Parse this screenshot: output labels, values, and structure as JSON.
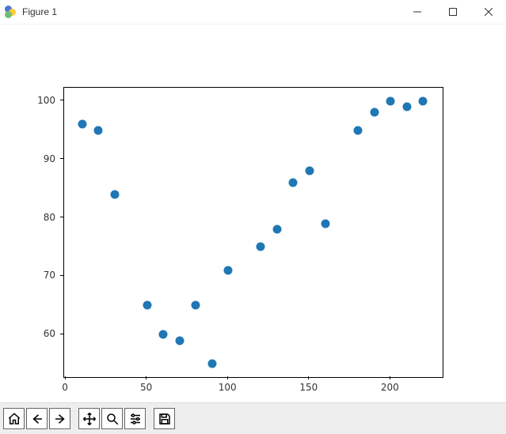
{
  "window": {
    "title": "Figure 1"
  },
  "chart_data": {
    "type": "scatter",
    "x": [
      10,
      20,
      30,
      50,
      60,
      70,
      80,
      90,
      100,
      120,
      130,
      140,
      150,
      160,
      180,
      190,
      200,
      210,
      220
    ],
    "y": [
      96,
      95,
      84,
      65,
      60,
      59,
      65,
      55,
      71,
      75,
      78,
      86,
      88,
      79,
      95,
      98,
      100,
      99,
      100
    ],
    "xlabel": "",
    "ylabel": "",
    "title": "",
    "xlim": [
      -1,
      232
    ],
    "ylim": [
      52.75,
      102.25
    ],
    "xticks": [
      0,
      50,
      100,
      150,
      200
    ],
    "yticks": [
      60,
      70,
      80,
      90,
      100
    ],
    "marker_color": "#1f77b4"
  },
  "toolbar": {
    "home": "Home",
    "back": "Back",
    "forward": "Forward",
    "pan": "Pan",
    "zoom": "Zoom",
    "configure": "Configure subplots",
    "save": "Save"
  }
}
